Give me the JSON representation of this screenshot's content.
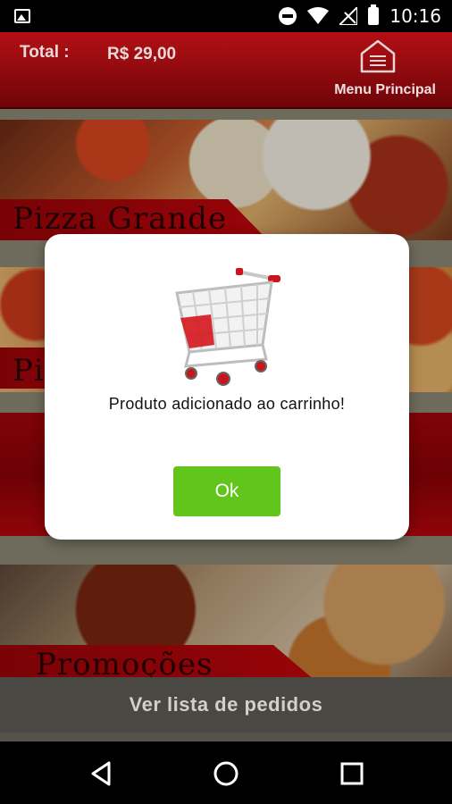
{
  "status_bar": {
    "time": "10:16",
    "icons": [
      "image-icon",
      "do-not-disturb-icon",
      "wifi-icon",
      "no-signal-icon",
      "battery-icon"
    ]
  },
  "header": {
    "total_label": "Total :",
    "total_value": "R$ 29,00",
    "menu_label": "Menu Principal",
    "menu_icon": "home-icon"
  },
  "categories": [
    {
      "label": "Pizza Grande"
    },
    {
      "label": "Pi"
    },
    {
      "label": ""
    },
    {
      "label": "Promoções"
    }
  ],
  "dialog": {
    "icon": "shopping-cart-icon",
    "message": "Produto adicionado ao carrinho!",
    "ok_label": "Ok"
  },
  "bottom": {
    "list_button_label": "Ver lista de pedidos"
  },
  "nav": {
    "icons": [
      "back-icon",
      "home-icon",
      "recents-icon"
    ]
  },
  "colors": {
    "header_red": "#8d0a0e",
    "ok_green": "#62c51b",
    "bottom_bar": "#4a4842"
  }
}
